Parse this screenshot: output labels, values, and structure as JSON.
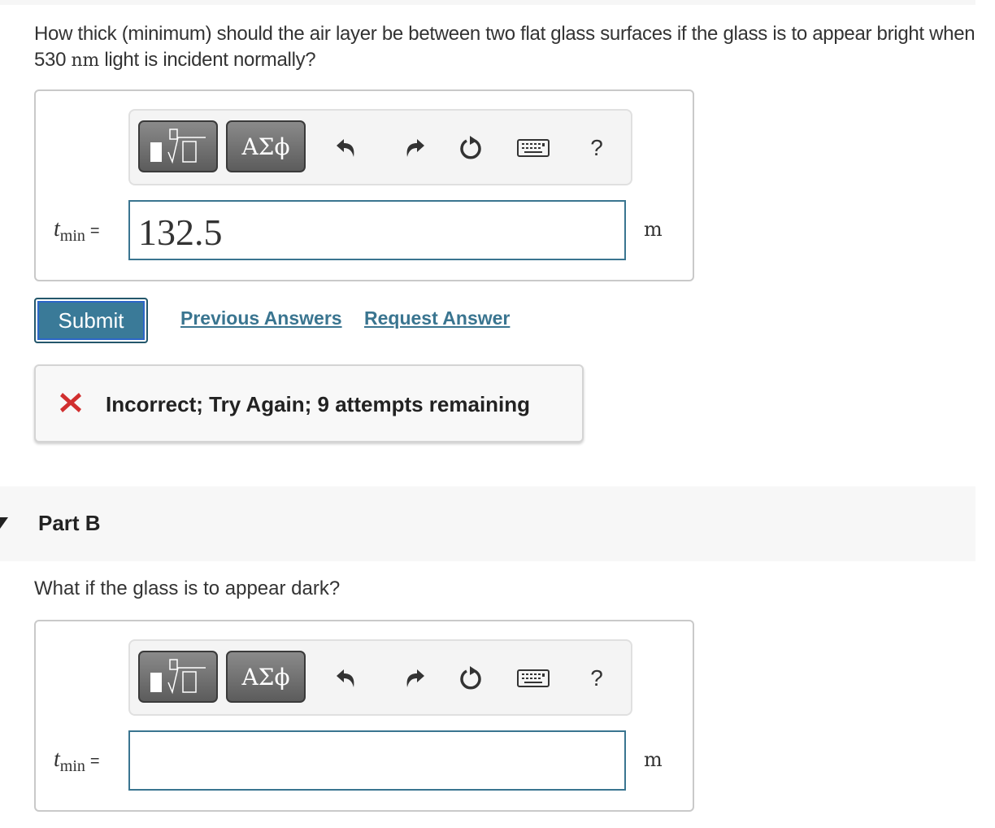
{
  "partA": {
    "question_pre": "How thick (minimum) should the air layer be between two flat glass surfaces if the glass is to appear bright when 530 ",
    "question_unit": "nm",
    "question_post": " light is incident normally?",
    "toolbar": {
      "template_button": "templates-icon",
      "greek_button_label": "ΑΣϕ",
      "undo": "undo-icon",
      "redo": "redo-icon",
      "reset": "reset-icon",
      "keyboard": "keyboard-icon",
      "help_label": "?"
    },
    "variable": "t",
    "subscript": "min",
    "equals": "=",
    "answer_value": "132.5",
    "unit": "m",
    "submit_label": "Submit",
    "previous_answers_label": "Previous Answers",
    "request_answer_label": "Request Answer",
    "feedback": {
      "status": "incorrect",
      "message": "Incorrect; Try Again; 9 attempts remaining",
      "icon_color": "#d12f2f"
    }
  },
  "partB": {
    "title": "Part B",
    "question": "What if the glass is to appear dark?",
    "toolbar": {
      "greek_button_label": "ΑΣϕ",
      "help_label": "?"
    },
    "variable": "t",
    "subscript": "min",
    "equals": "=",
    "answer_value": "",
    "unit": "m"
  },
  "colors": {
    "accent": "#3a7590",
    "submit_bg": "#3a7a98",
    "error": "#d12f2f"
  }
}
